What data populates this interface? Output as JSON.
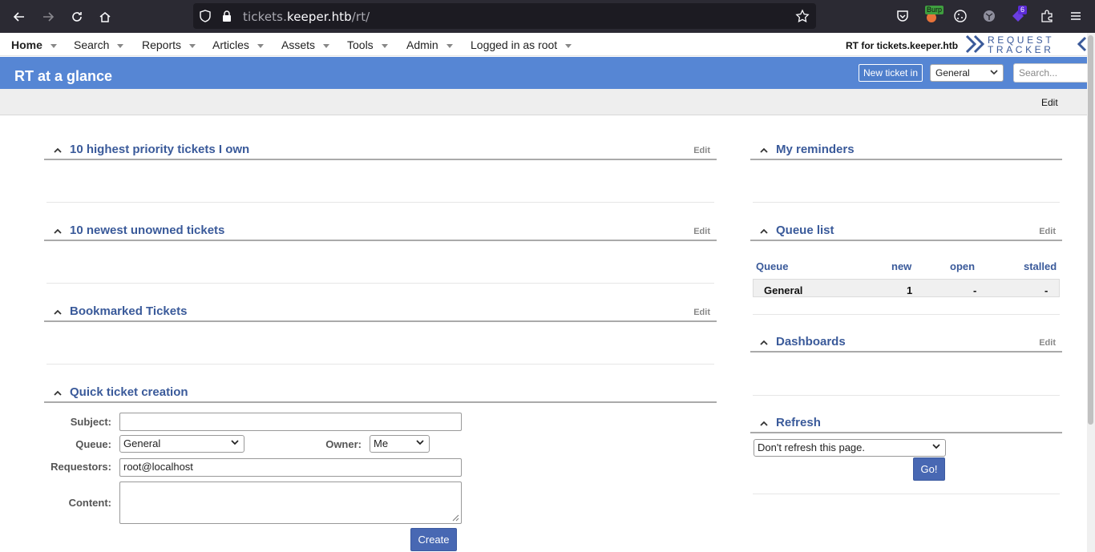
{
  "browser": {
    "url_host": "tickets.keeper.htb",
    "url_prefix": "tickets.",
    "url_domain": "keeper.htb",
    "url_path": "/rt/",
    "burp_badge": "Burp",
    "ext_badge_count": "6"
  },
  "nav": {
    "items": [
      "Home",
      "Search",
      "Reports",
      "Articles",
      "Assets",
      "Tools",
      "Admin",
      "Logged in as root"
    ],
    "rt_for": "RT for tickets.keeper.htb",
    "logo_top": "REQUEST",
    "logo_bottom": "TRACKER"
  },
  "header": {
    "title": "RT at a glance",
    "new_ticket_label": "New ticket in",
    "queue_selected": "General",
    "search_placeholder": "Search..."
  },
  "page_menu": {
    "edit_label": "Edit"
  },
  "portlets": {
    "priority": {
      "title": "10 highest priority tickets I own",
      "edit": "Edit"
    },
    "unowned": {
      "title": "10 newest unowned tickets",
      "edit": "Edit"
    },
    "bookmarked": {
      "title": "Bookmarked Tickets",
      "edit": "Edit"
    },
    "quick": {
      "title": "Quick ticket creation"
    },
    "reminders": {
      "title": "My reminders"
    },
    "queue_list": {
      "title": "Queue list",
      "edit": "Edit"
    },
    "dashboards": {
      "title": "Dashboards",
      "edit": "Edit"
    },
    "refresh": {
      "title": "Refresh"
    }
  },
  "quick_form": {
    "subject_label": "Subject:",
    "subject_value": "",
    "queue_label": "Queue:",
    "queue_value": "General",
    "owner_label": "Owner:",
    "owner_value": "Me",
    "requestors_label": "Requestors:",
    "requestors_value": "root@localhost",
    "content_label": "Content:",
    "content_value": "",
    "create_label": "Create"
  },
  "queue_table": {
    "headers": [
      "Queue",
      "new",
      "open",
      "stalled"
    ],
    "rows": [
      {
        "queue": "General",
        "new": "1",
        "open": "-",
        "stalled": "-"
      }
    ]
  },
  "refresh_form": {
    "selected": "Don't refresh this page.",
    "go_label": "Go!"
  },
  "colors": {
    "title_bar": "#5686d4",
    "portlet_title": "#3a5a9a",
    "button_blue": "#4868b3"
  }
}
